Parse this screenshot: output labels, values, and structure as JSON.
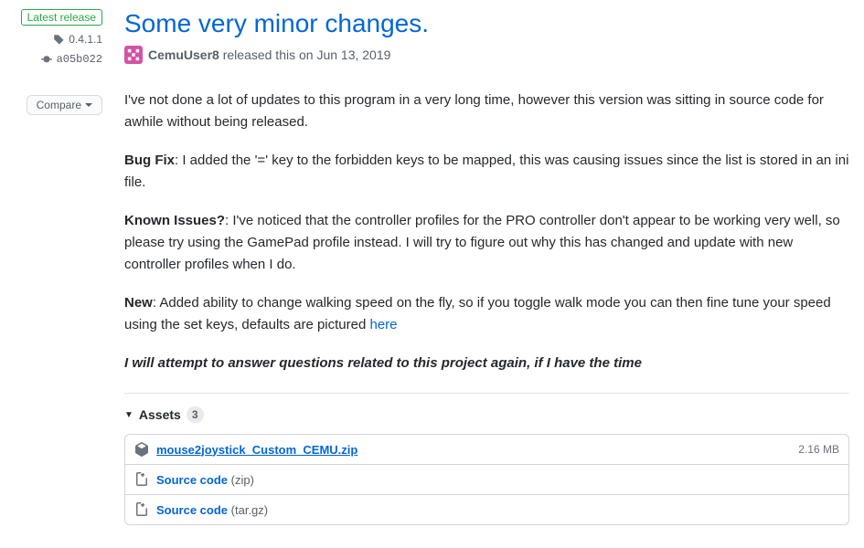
{
  "sidebar": {
    "latest_label": "Latest release",
    "tag": "0.4.1.1",
    "commit": "a05b022",
    "compare_label": "Compare"
  },
  "release": {
    "title": "Some very minor changes.",
    "author": "CemuUser8",
    "meta_text_prefix": " released this ",
    "date": "on Jun 13, 2019"
  },
  "body": {
    "intro": "I've not done a lot of updates to this program in a very long time, however this version was sitting in source code for awhile without being released.",
    "bugfix_label": "Bug Fix",
    "bugfix_text": ": I added the '=' key to the forbidden keys to be mapped, this was causing issues since the list is stored in an ini file.",
    "issues_label": "Known Issues?",
    "issues_text": ": I've noticed that the controller profiles for the PRO controller don't appear to be working very well, so please try using the GamePad profile instead. I will try to figure out why this has changed and update with new controller profiles when I do.",
    "new_label": "New",
    "new_text": ": Added ability to change walking speed on the fly, so if you toggle walk mode you can then fine tune your speed using the set keys, defaults are pictured ",
    "new_link": "here",
    "closing": "I will attempt to answer questions related to this project again, if I have the time"
  },
  "assets": {
    "header": "Assets",
    "count": "3",
    "items": [
      {
        "name": "mouse2joystick_Custom_CEMU.zip",
        "size": "2.16 MB",
        "type": "package"
      },
      {
        "name": "Source code",
        "format": "(zip)",
        "type": "source"
      },
      {
        "name": "Source code",
        "format": "(tar.gz)",
        "type": "source"
      }
    ]
  }
}
